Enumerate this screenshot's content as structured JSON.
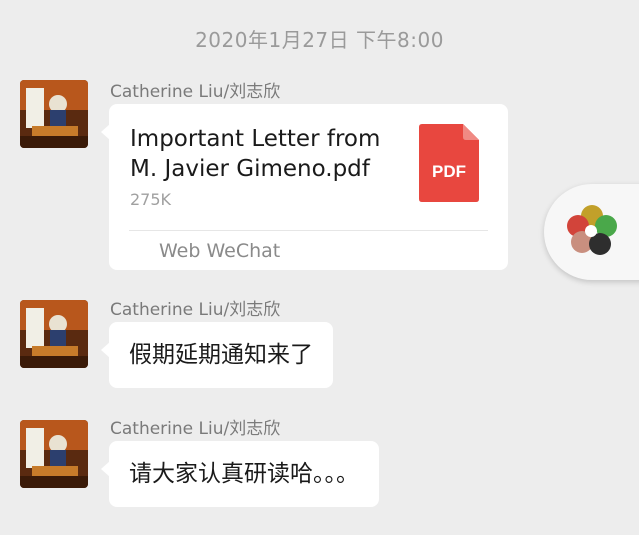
{
  "timestamp": "2020年1月27日 下午8:00",
  "messages": [
    {
      "sender": "Catherine Liu/刘志欣",
      "type": "file",
      "file": {
        "title_line1": "Important Letter from",
        "title_line2": "M. Javier Gimeno.pdf",
        "size": "275K",
        "icon_label": "PDF",
        "source": "Web WeChat"
      }
    },
    {
      "sender": "Catherine Liu/刘志欣",
      "type": "text",
      "text": "假期延期通知来了"
    },
    {
      "sender": "Catherine Liu/刘志欣",
      "type": "text",
      "text": "请大家认真研读哈。。。"
    }
  ],
  "floating_button": {
    "icon": "multicolor-flower-icon"
  },
  "colors": {
    "background": "#ededed",
    "bubble": "#ffffff",
    "pdf_red": "#e8473f",
    "timestamp_text": "#9a9a9a"
  }
}
